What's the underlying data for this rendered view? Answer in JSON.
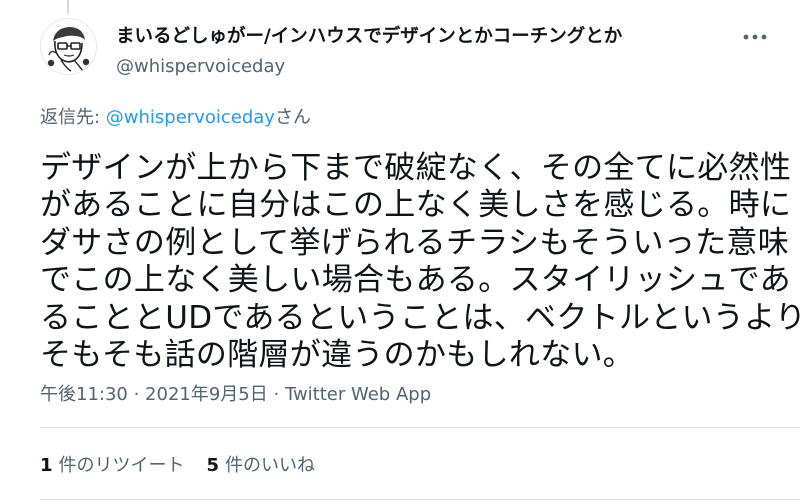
{
  "author": {
    "display_name": "まいるどしゅがー/インハウスでデザインとかコーチングとか",
    "handle": "@whispervoiceday"
  },
  "reply": {
    "prefix": "返信先: ",
    "mention": "@whispervoiceday",
    "suffix": "さん"
  },
  "tweet": {
    "lines": [
      "デザインが上から下まで破綻なく、その全てに必然性",
      "があることに自分はこの上なく美しさを感じる。時に",
      "ダサさの例として挙げられるチラシもそういった意味",
      "でこの上なく美しい場合もある。スタイリッシュであ",
      "ることとUDであるということは、ベクトルというより",
      "そもそも話の階層が違うのかもしれない。"
    ]
  },
  "meta": {
    "time": "午後11:30",
    "separator": " · ",
    "date": "2021年9月5日",
    "app": "Twitter Web App"
  },
  "stats": {
    "retweets": {
      "count": "1",
      "label": "件のリツイート"
    },
    "likes": {
      "count": "5",
      "label": "件のいいね"
    }
  },
  "icons": {
    "more": "more-horizontal-icon",
    "avatar": "avatar-illustration"
  },
  "colors": {
    "text": "#0f1419",
    "secondary": "#536471",
    "link": "#1d9bf0",
    "divider": "#e1e6ea"
  }
}
